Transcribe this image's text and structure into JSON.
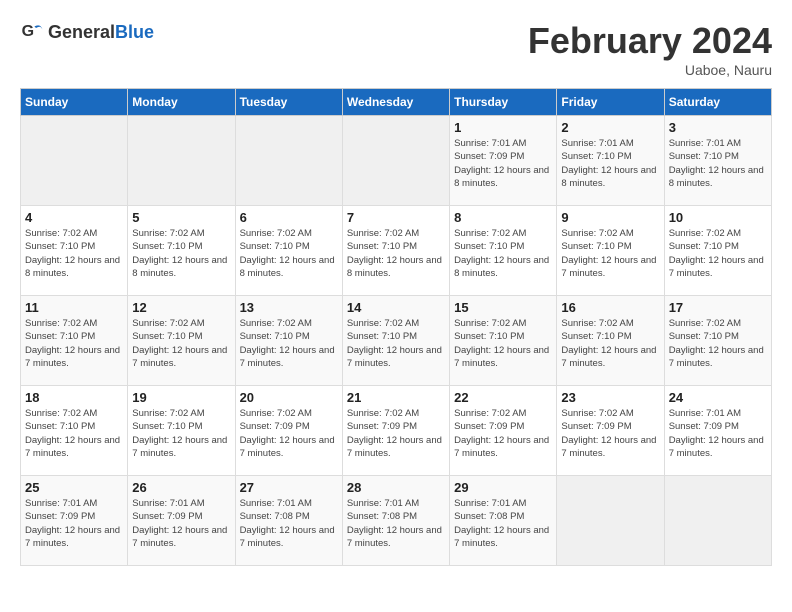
{
  "header": {
    "logo_general": "General",
    "logo_blue": "Blue",
    "title": "February 2024",
    "subtitle": "Uaboe, Nauru"
  },
  "weekdays": [
    "Sunday",
    "Monday",
    "Tuesday",
    "Wednesday",
    "Thursday",
    "Friday",
    "Saturday"
  ],
  "weeks": [
    [
      {
        "day": null
      },
      {
        "day": null
      },
      {
        "day": null
      },
      {
        "day": null
      },
      {
        "day": "1",
        "sunrise": "7:01 AM",
        "sunset": "7:09 PM",
        "daylight": "12 hours and 8 minutes."
      },
      {
        "day": "2",
        "sunrise": "7:01 AM",
        "sunset": "7:10 PM",
        "daylight": "12 hours and 8 minutes."
      },
      {
        "day": "3",
        "sunrise": "7:01 AM",
        "sunset": "7:10 PM",
        "daylight": "12 hours and 8 minutes."
      }
    ],
    [
      {
        "day": "4",
        "sunrise": "7:02 AM",
        "sunset": "7:10 PM",
        "daylight": "12 hours and 8 minutes."
      },
      {
        "day": "5",
        "sunrise": "7:02 AM",
        "sunset": "7:10 PM",
        "daylight": "12 hours and 8 minutes."
      },
      {
        "day": "6",
        "sunrise": "7:02 AM",
        "sunset": "7:10 PM",
        "daylight": "12 hours and 8 minutes."
      },
      {
        "day": "7",
        "sunrise": "7:02 AM",
        "sunset": "7:10 PM",
        "daylight": "12 hours and 8 minutes."
      },
      {
        "day": "8",
        "sunrise": "7:02 AM",
        "sunset": "7:10 PM",
        "daylight": "12 hours and 8 minutes."
      },
      {
        "day": "9",
        "sunrise": "7:02 AM",
        "sunset": "7:10 PM",
        "daylight": "12 hours and 7 minutes."
      },
      {
        "day": "10",
        "sunrise": "7:02 AM",
        "sunset": "7:10 PM",
        "daylight": "12 hours and 7 minutes."
      }
    ],
    [
      {
        "day": "11",
        "sunrise": "7:02 AM",
        "sunset": "7:10 PM",
        "daylight": "12 hours and 7 minutes."
      },
      {
        "day": "12",
        "sunrise": "7:02 AM",
        "sunset": "7:10 PM",
        "daylight": "12 hours and 7 minutes."
      },
      {
        "day": "13",
        "sunrise": "7:02 AM",
        "sunset": "7:10 PM",
        "daylight": "12 hours and 7 minutes."
      },
      {
        "day": "14",
        "sunrise": "7:02 AM",
        "sunset": "7:10 PM",
        "daylight": "12 hours and 7 minutes."
      },
      {
        "day": "15",
        "sunrise": "7:02 AM",
        "sunset": "7:10 PM",
        "daylight": "12 hours and 7 minutes."
      },
      {
        "day": "16",
        "sunrise": "7:02 AM",
        "sunset": "7:10 PM",
        "daylight": "12 hours and 7 minutes."
      },
      {
        "day": "17",
        "sunrise": "7:02 AM",
        "sunset": "7:10 PM",
        "daylight": "12 hours and 7 minutes."
      }
    ],
    [
      {
        "day": "18",
        "sunrise": "7:02 AM",
        "sunset": "7:10 PM",
        "daylight": "12 hours and 7 minutes."
      },
      {
        "day": "19",
        "sunrise": "7:02 AM",
        "sunset": "7:10 PM",
        "daylight": "12 hours and 7 minutes."
      },
      {
        "day": "20",
        "sunrise": "7:02 AM",
        "sunset": "7:09 PM",
        "daylight": "12 hours and 7 minutes."
      },
      {
        "day": "21",
        "sunrise": "7:02 AM",
        "sunset": "7:09 PM",
        "daylight": "12 hours and 7 minutes."
      },
      {
        "day": "22",
        "sunrise": "7:02 AM",
        "sunset": "7:09 PM",
        "daylight": "12 hours and 7 minutes."
      },
      {
        "day": "23",
        "sunrise": "7:02 AM",
        "sunset": "7:09 PM",
        "daylight": "12 hours and 7 minutes."
      },
      {
        "day": "24",
        "sunrise": "7:01 AM",
        "sunset": "7:09 PM",
        "daylight": "12 hours and 7 minutes."
      }
    ],
    [
      {
        "day": "25",
        "sunrise": "7:01 AM",
        "sunset": "7:09 PM",
        "daylight": "12 hours and 7 minutes."
      },
      {
        "day": "26",
        "sunrise": "7:01 AM",
        "sunset": "7:09 PM",
        "daylight": "12 hours and 7 minutes."
      },
      {
        "day": "27",
        "sunrise": "7:01 AM",
        "sunset": "7:08 PM",
        "daylight": "12 hours and 7 minutes."
      },
      {
        "day": "28",
        "sunrise": "7:01 AM",
        "sunset": "7:08 PM",
        "daylight": "12 hours and 7 minutes."
      },
      {
        "day": "29",
        "sunrise": "7:01 AM",
        "sunset": "7:08 PM",
        "daylight": "12 hours and 7 minutes."
      },
      {
        "day": null
      },
      {
        "day": null
      }
    ]
  ],
  "labels": {
    "sunrise_prefix": "Sunrise: ",
    "sunset_prefix": "Sunset: ",
    "daylight_prefix": "Daylight: "
  }
}
